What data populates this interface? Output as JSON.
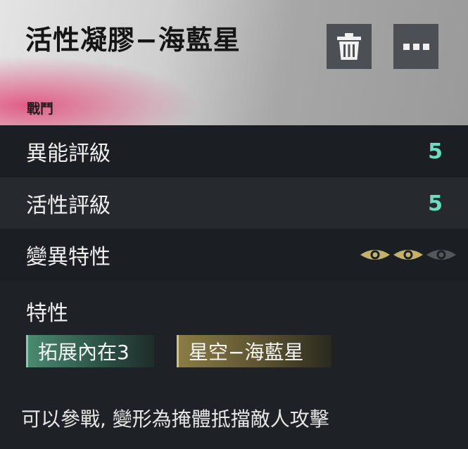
{
  "header": {
    "title": "活性凝膠−海藍星",
    "category": "戰鬥",
    "delete_icon": "trash-icon",
    "more_icon": "more-icon"
  },
  "stats": [
    {
      "label": "異能評級",
      "value": "5"
    },
    {
      "label": "活性評級",
      "value": "5"
    }
  ],
  "mutation": {
    "label": "變異特性",
    "level": 2,
    "max": 3,
    "icon": "eye-icon",
    "active_color": "#c3b36a",
    "inactive_color": "#55585b"
  },
  "traits": {
    "title": "特性",
    "tags": [
      "拓展內在3",
      "星空−海藍星"
    ]
  },
  "description": "可以參戰, 變形為掩體抵擋敵人攻擊"
}
